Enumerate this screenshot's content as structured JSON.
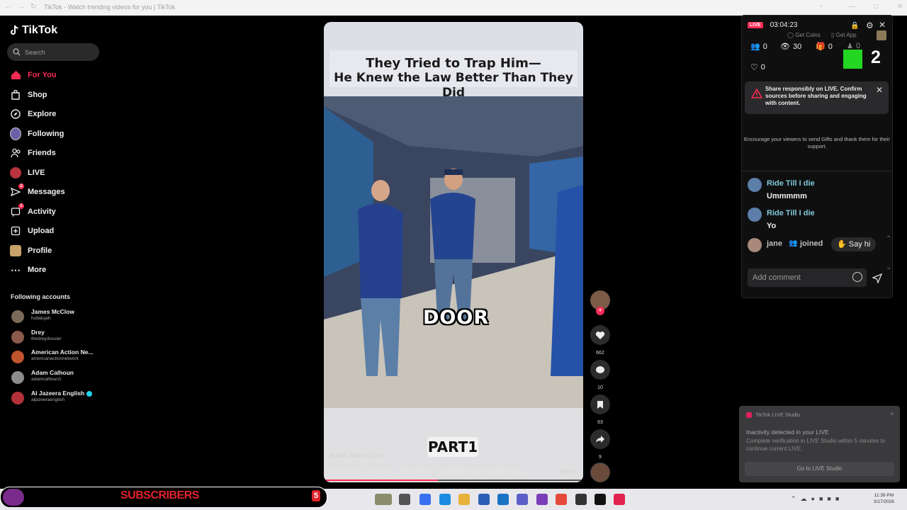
{
  "browser": {
    "tab_title": "TikTok - Watch trending videos for you | TikTok"
  },
  "sidebar": {
    "logo": "TikTok",
    "search_placeholder": "Search",
    "nav": [
      {
        "label": "For You",
        "icon": "home-icon"
      },
      {
        "label": "Shop",
        "icon": "shop-icon"
      },
      {
        "label": "Explore",
        "icon": "compass-icon"
      },
      {
        "label": "Following",
        "icon": "following-icon"
      },
      {
        "label": "Friends",
        "icon": "friends-icon"
      },
      {
        "label": "LIVE",
        "icon": "live-icon"
      },
      {
        "label": "Messages",
        "icon": "messages-icon",
        "badge": "2"
      },
      {
        "label": "Activity",
        "icon": "activity-icon",
        "badge": "1"
      },
      {
        "label": "Upload",
        "icon": "upload-icon"
      },
      {
        "label": "Profile",
        "icon": "profile-icon"
      },
      {
        "label": "More",
        "icon": "more-icon"
      }
    ],
    "following_header": "Following accounts",
    "accounts": [
      {
        "name": "James McClow",
        "handle": "hullalujah"
      },
      {
        "name": "Drey",
        "handle": "thedreydossier"
      },
      {
        "name": "American Action Ne...",
        "handle": "americanactionnetwork"
      },
      {
        "name": "Adam Calhoun",
        "handle": "adamcalhoun1"
      },
      {
        "name": "Al Jazeera English",
        "handle": "aljazeeraenglish"
      }
    ]
  },
  "video": {
    "title_line1": "They Tried to Trap Him—",
    "title_line2": "He Knew the Law Better Than They Did",
    "caption_word": "DOOR",
    "part_label": "PART1",
    "author": "audit.zone.clips",
    "description": "They Tried to Trap Him — He Knew the Law Better Than They Did. Part1...",
    "more": "more",
    "likes": "662",
    "comments": "10",
    "saves": "63",
    "shares": "9"
  },
  "live_panel": {
    "badge": "LIVE",
    "timer": "03:04:23",
    "get_coins": "Get Coins",
    "get_app": "Get App",
    "stats": {
      "viewers": "0",
      "views": "30",
      "gifts": "0",
      "shares": "0",
      "likes": "0",
      "big_count": "2"
    },
    "warning": "Share responsibly on LIVE. Confirm sources before sharing and engaging with content.",
    "encourage": "Encourage your viewers to send Gifts and thank them for their support.",
    "messages": [
      {
        "user": "Ride Till I die",
        "text": "Ummmmm"
      },
      {
        "user": "Ride Till I die",
        "text": "Yo"
      }
    ],
    "join": {
      "user": "jane",
      "action": "joined",
      "button": "Say hi"
    },
    "comment_placeholder": "Add comment"
  },
  "toast": {
    "app": "TikTok LIVE Studio",
    "line1": "Inactivity detected in your LIVE",
    "line2": "Complete verification in LIVE Studio within 5 minutes to continue current LIVE.",
    "button": "Go to LIVE Studio"
  },
  "overlay": {
    "subscribers_label": "SUBSCRIBERS",
    "count": "5"
  },
  "taskbar": {
    "time": "11:39 PM",
    "date": "3/17/2026"
  },
  "colors": {
    "accent": "#fe2c55",
    "live_user": "#7fc8d9",
    "subs_red": "#e0232b"
  }
}
